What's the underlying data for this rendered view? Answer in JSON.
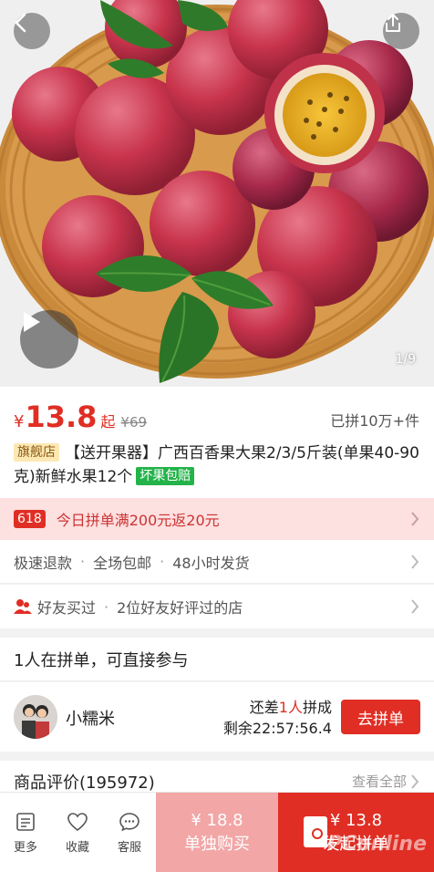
{
  "hero": {
    "page_indicator": "1/9"
  },
  "price": {
    "currency": "¥",
    "value": "13.8",
    "suffix": "起",
    "original": "¥69",
    "sold": "已拼10万+件"
  },
  "product": {
    "flag_tag": "旗舰店",
    "title": "【送开果器】广西百香果大果2/3/5斤装(单果40-90克)新鲜水果12个",
    "guarantee_tag": "坏果包赔"
  },
  "promo": {
    "badge": "618",
    "text": "今日拼单满200元返20元"
  },
  "services": [
    "极速退款",
    "全场包邮",
    "48小时发货"
  ],
  "friends": {
    "label": "好友买过",
    "detail": "2位好友好评过的店"
  },
  "group_section": {
    "header": "1人在拼单，可直接参与",
    "user_name": "小糯米",
    "need_prefix": "还差",
    "need_count": "1人",
    "need_suffix": "拼成",
    "remaining": "剩余22:57:56.4",
    "join_label": "去拼单"
  },
  "reviews": {
    "label": "商品评价(195972)",
    "view_all": "查看全部"
  },
  "bottom_bar": {
    "tools": [
      {
        "label": "更多",
        "icon": "list-icon"
      },
      {
        "label": "收藏",
        "icon": "heart-icon"
      },
      {
        "label": "客服",
        "icon": "chat-icon"
      }
    ],
    "solo_price": "¥ 18.8",
    "solo_label": "单独购买",
    "group_price": "¥ 13.8",
    "group_label": "发起拼单"
  },
  "watermark": "PConline",
  "colors": {
    "accent": "#e02e24",
    "promo_bg": "#fde0e0",
    "solo_bg": "#f2a6a6",
    "green_tag": "#24b34a"
  }
}
